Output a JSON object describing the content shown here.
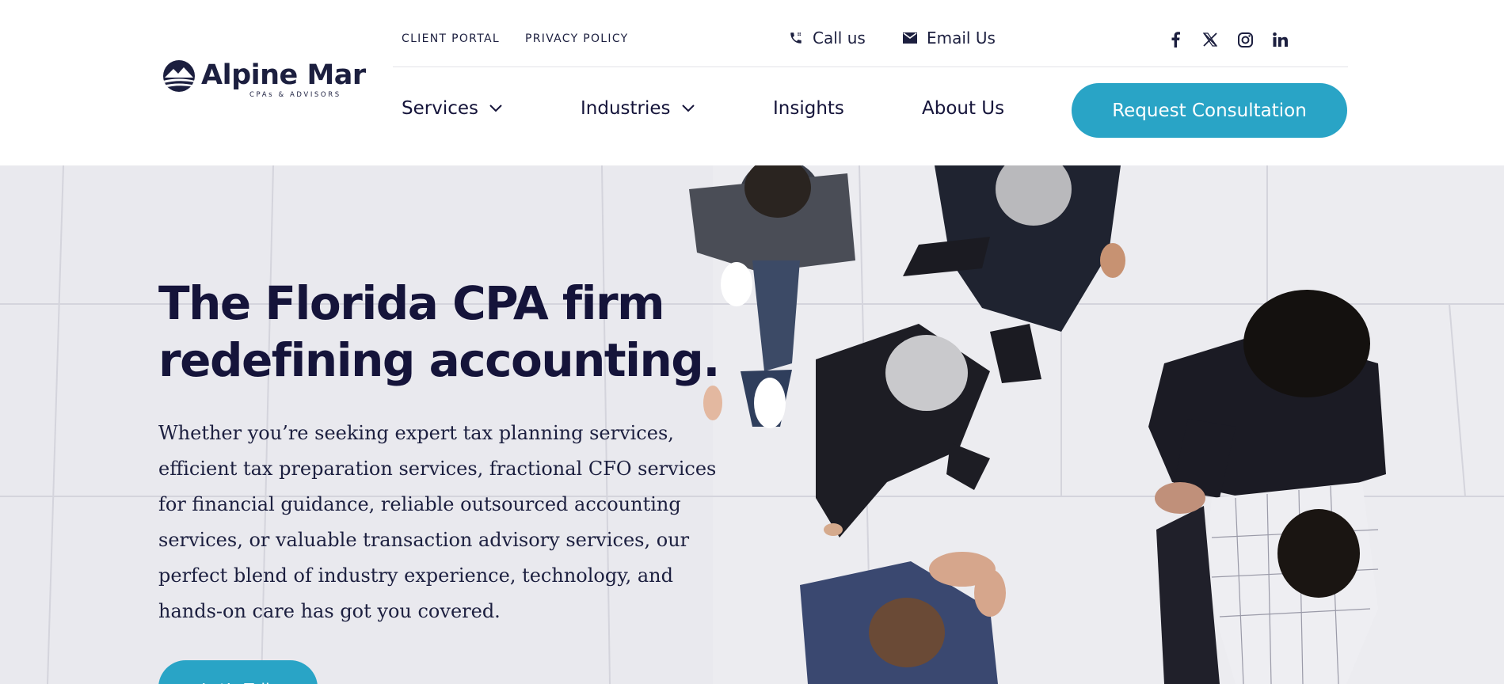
{
  "brand": {
    "name": "Alpine Mar",
    "tagline": "CPAs & ADVISORS",
    "accent_color": "#29a4c6",
    "navy_color": "#15143a"
  },
  "utility_nav": {
    "client_portal": "CLIENT PORTAL",
    "privacy_policy": "PRIVACY POLICY",
    "call_label": "Call us",
    "email_label": "Email Us",
    "social_icons": [
      "facebook-icon",
      "x-twitter-icon",
      "instagram-icon",
      "linkedin-icon"
    ]
  },
  "main_nav": {
    "services": "Services",
    "industries": "Industries",
    "insights": "Insights",
    "about": "About Us",
    "cta": "Request Consultation"
  },
  "hero": {
    "title_line1": "The Florida CPA firm",
    "title_line2": "redefining accounting.",
    "body_lines": [
      "Whether you’re seeking expert tax planning services,",
      "efficient tax preparation services, fractional CFO services",
      "for financial guidance, reliable outsourced accounting",
      "services, or valuable transaction advisory services, our",
      "perfect blend of industry experience, technology, and",
      "hands-on care has got you covered."
    ],
    "button": "Let’s Talk"
  }
}
